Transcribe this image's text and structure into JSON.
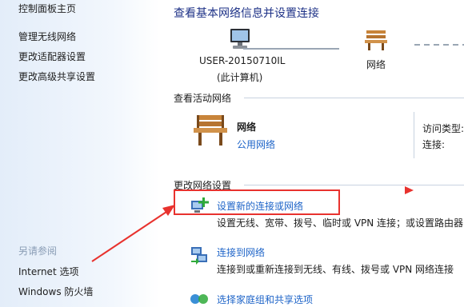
{
  "sidebar": {
    "home": "控制面板主页",
    "items": [
      "管理无线网络",
      "更改适配器设置",
      "更改高级共享设置"
    ],
    "see_also_title": "另请参阅",
    "see_also": [
      "Internet 选项",
      "Windows 防火墙"
    ]
  },
  "main": {
    "title": "查看基本网络信息并设置连接",
    "map": {
      "computer_name": "USER-20150710IL",
      "computer_sub": "(此计算机)",
      "network_label": "网络"
    },
    "active": {
      "header": "查看活动网络",
      "network_name": "网络",
      "network_type": "公用网络",
      "access_type_label": "访问类型:",
      "connection_label": "连接:"
    },
    "change": {
      "header": "更改网络设置",
      "tasks": [
        {
          "icon": "network-setup-icon",
          "link": "设置新的连接或网络",
          "desc": "设置无线、宽带、拨号、临时或 VPN 连接；或设置路由器"
        },
        {
          "icon": "connect-network-icon",
          "link": "连接到网络",
          "desc": "连接到或重新连接到无线、有线、拨号或 VPN 网络连接"
        },
        {
          "icon": "homegroup-icon",
          "link": "选择家庭组和共享选项",
          "desc": ""
        }
      ]
    }
  },
  "colors": {
    "accent": "#1e64c8",
    "title": "#1e3287",
    "annotation": "#e8322e"
  }
}
